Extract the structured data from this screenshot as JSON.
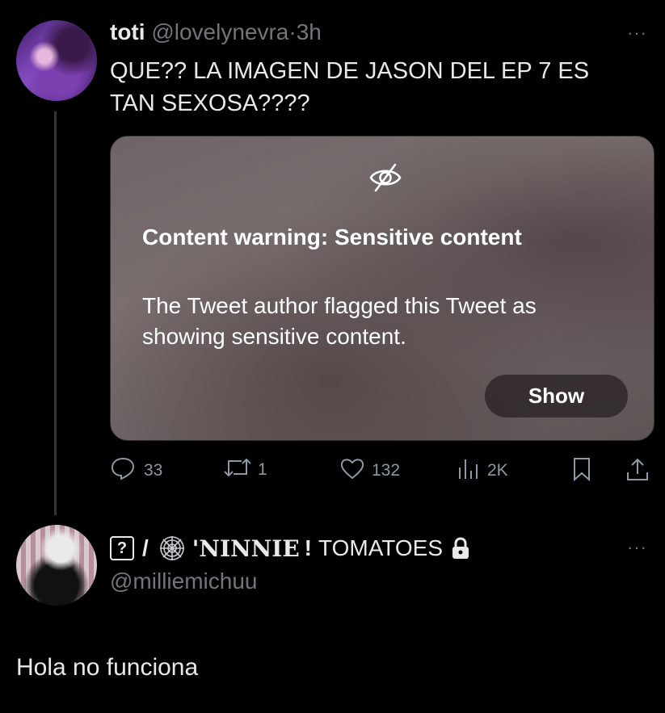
{
  "tweet": {
    "author_name": "toti",
    "handle": "@lovelynevra",
    "separator": "·",
    "time": "3h",
    "text_line1": "QUE?? LA IMAGEN DE JASON DEL EP 7 ES",
    "text_line2": "TAN SEXOSA????",
    "more_label": "···",
    "media_warning": {
      "title": "Content warning: Sensitive content",
      "body_line1": "The Tweet author flagged this Tweet as",
      "body_line2": "showing sensitive content.",
      "show_label": "Show",
      "icon": "eye-slash-icon"
    },
    "actions": {
      "replies": "33",
      "retweets": "1",
      "likes": "132",
      "views": "2K"
    }
  },
  "reply": {
    "name_prefix": "?",
    "slash": "/",
    "name_main": "'NINNIE",
    "exclaim": "!",
    "name_suffix": "TOMATOES",
    "handle": "@milliemichuu",
    "text": "Hola no funciona",
    "more_label": "···",
    "icons": [
      "question-box-icon",
      "spider-web-icon",
      "lock-icon"
    ]
  },
  "colors": {
    "background": "#000000",
    "text": "#e7e9ea",
    "muted": "#71767b"
  }
}
